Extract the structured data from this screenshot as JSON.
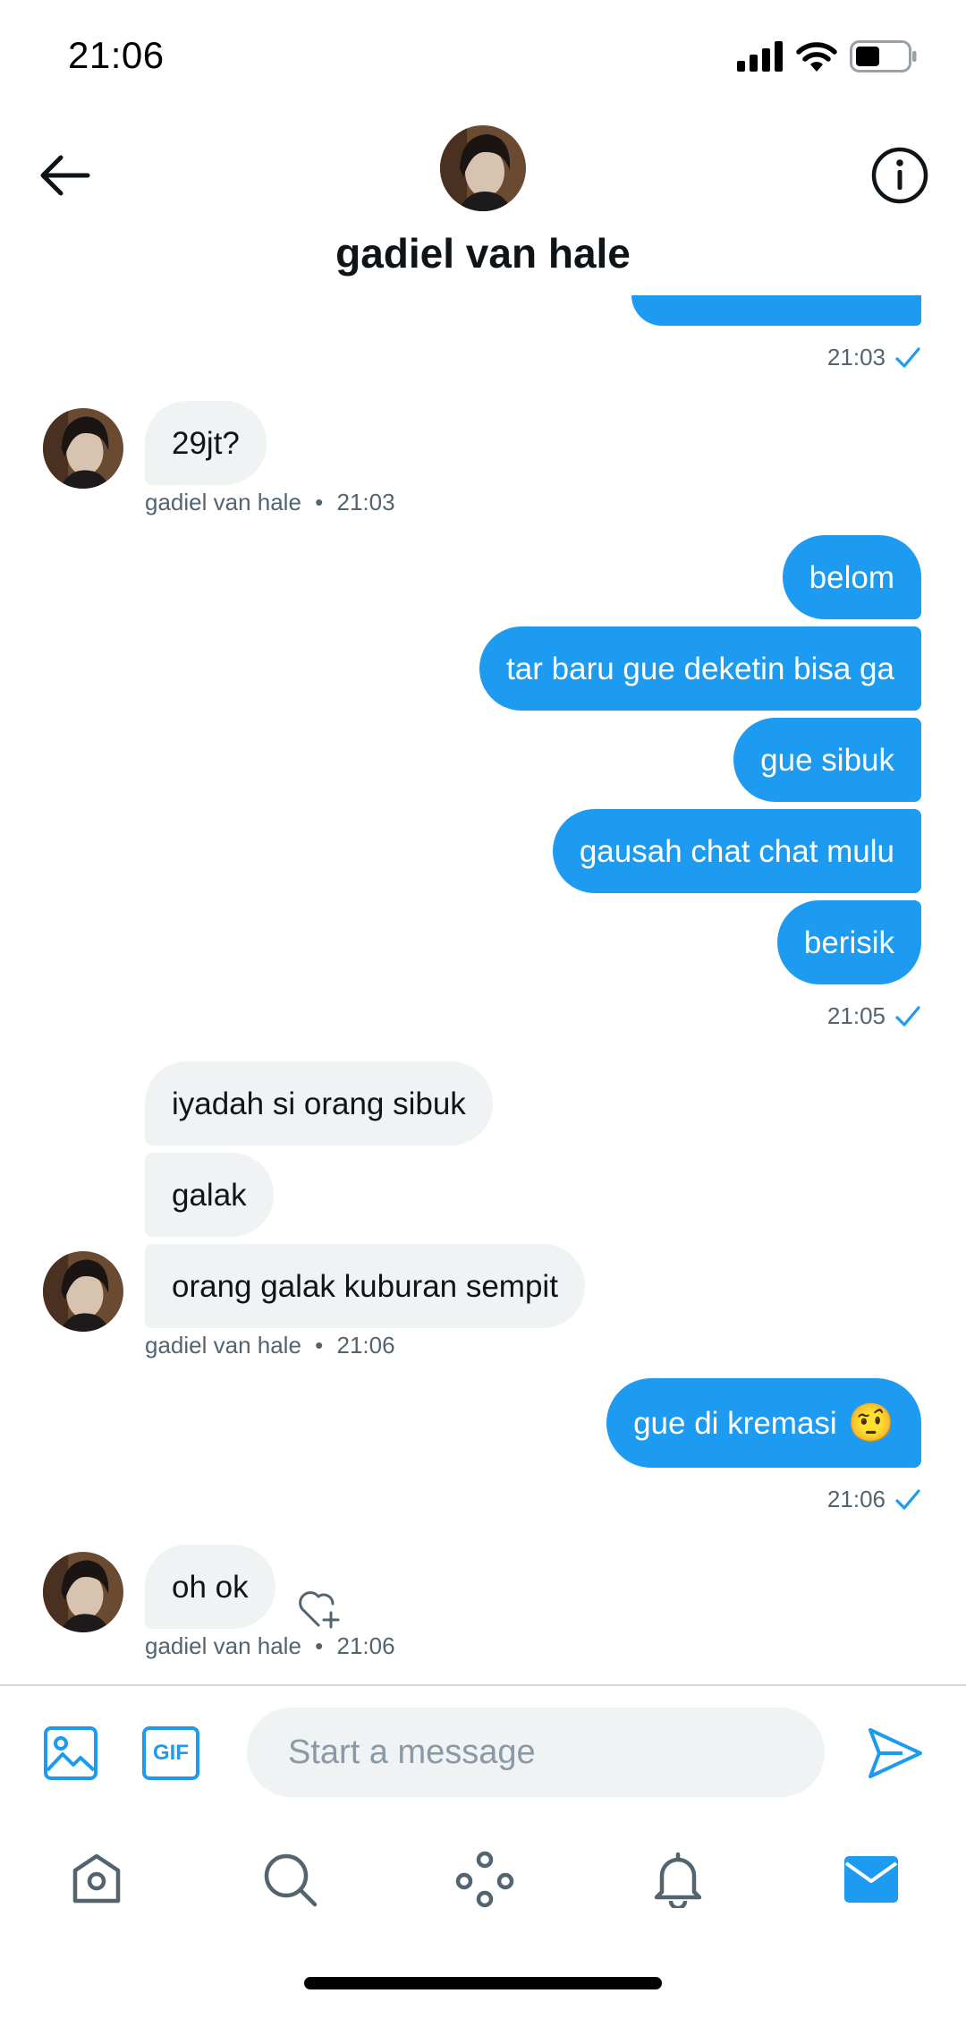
{
  "status_bar": {
    "time": "21:06"
  },
  "header": {
    "contact_name": "gadiel van hale"
  },
  "colors": {
    "accent": "#1d9bf0",
    "incoming_bubble": "#eff3f4",
    "meta_text": "#536471"
  },
  "messages": {
    "out_time_1": "21:03",
    "in_group_1": {
      "texts": [
        "29jt?"
      ],
      "sender": "gadiel van hale",
      "separator": "•",
      "time": "21:03"
    },
    "out_group_1": {
      "texts": [
        "belom",
        "tar baru gue deketin bisa ga",
        "gue sibuk",
        "gausah chat chat mulu",
        "berisik"
      ],
      "time": "21:05"
    },
    "in_group_2": {
      "texts": [
        "iyadah si orang sibuk",
        "galak",
        "orang galak kuburan sempit"
      ],
      "sender": "gadiel van hale",
      "separator": "•",
      "time": "21:06"
    },
    "out_group_2": {
      "text": "gue di kremasi",
      "emoji": "🤨",
      "time": "21:06"
    },
    "in_group_3": {
      "texts": [
        "oh ok"
      ],
      "sender": "gadiel van hale",
      "separator": "•",
      "time": "21:06"
    }
  },
  "composer": {
    "placeholder": "Start a message",
    "gif_label": "GIF"
  },
  "icons": {
    "back": "arrow-left-icon",
    "info": "info-icon",
    "media": "image-icon",
    "gif": "gif-icon",
    "send": "send-icon",
    "react": "heart-plus-icon",
    "read_receipt": "checkmark-icon",
    "tabs": [
      "home-icon",
      "search-icon",
      "communities-icon",
      "notifications-icon",
      "messages-icon"
    ]
  }
}
